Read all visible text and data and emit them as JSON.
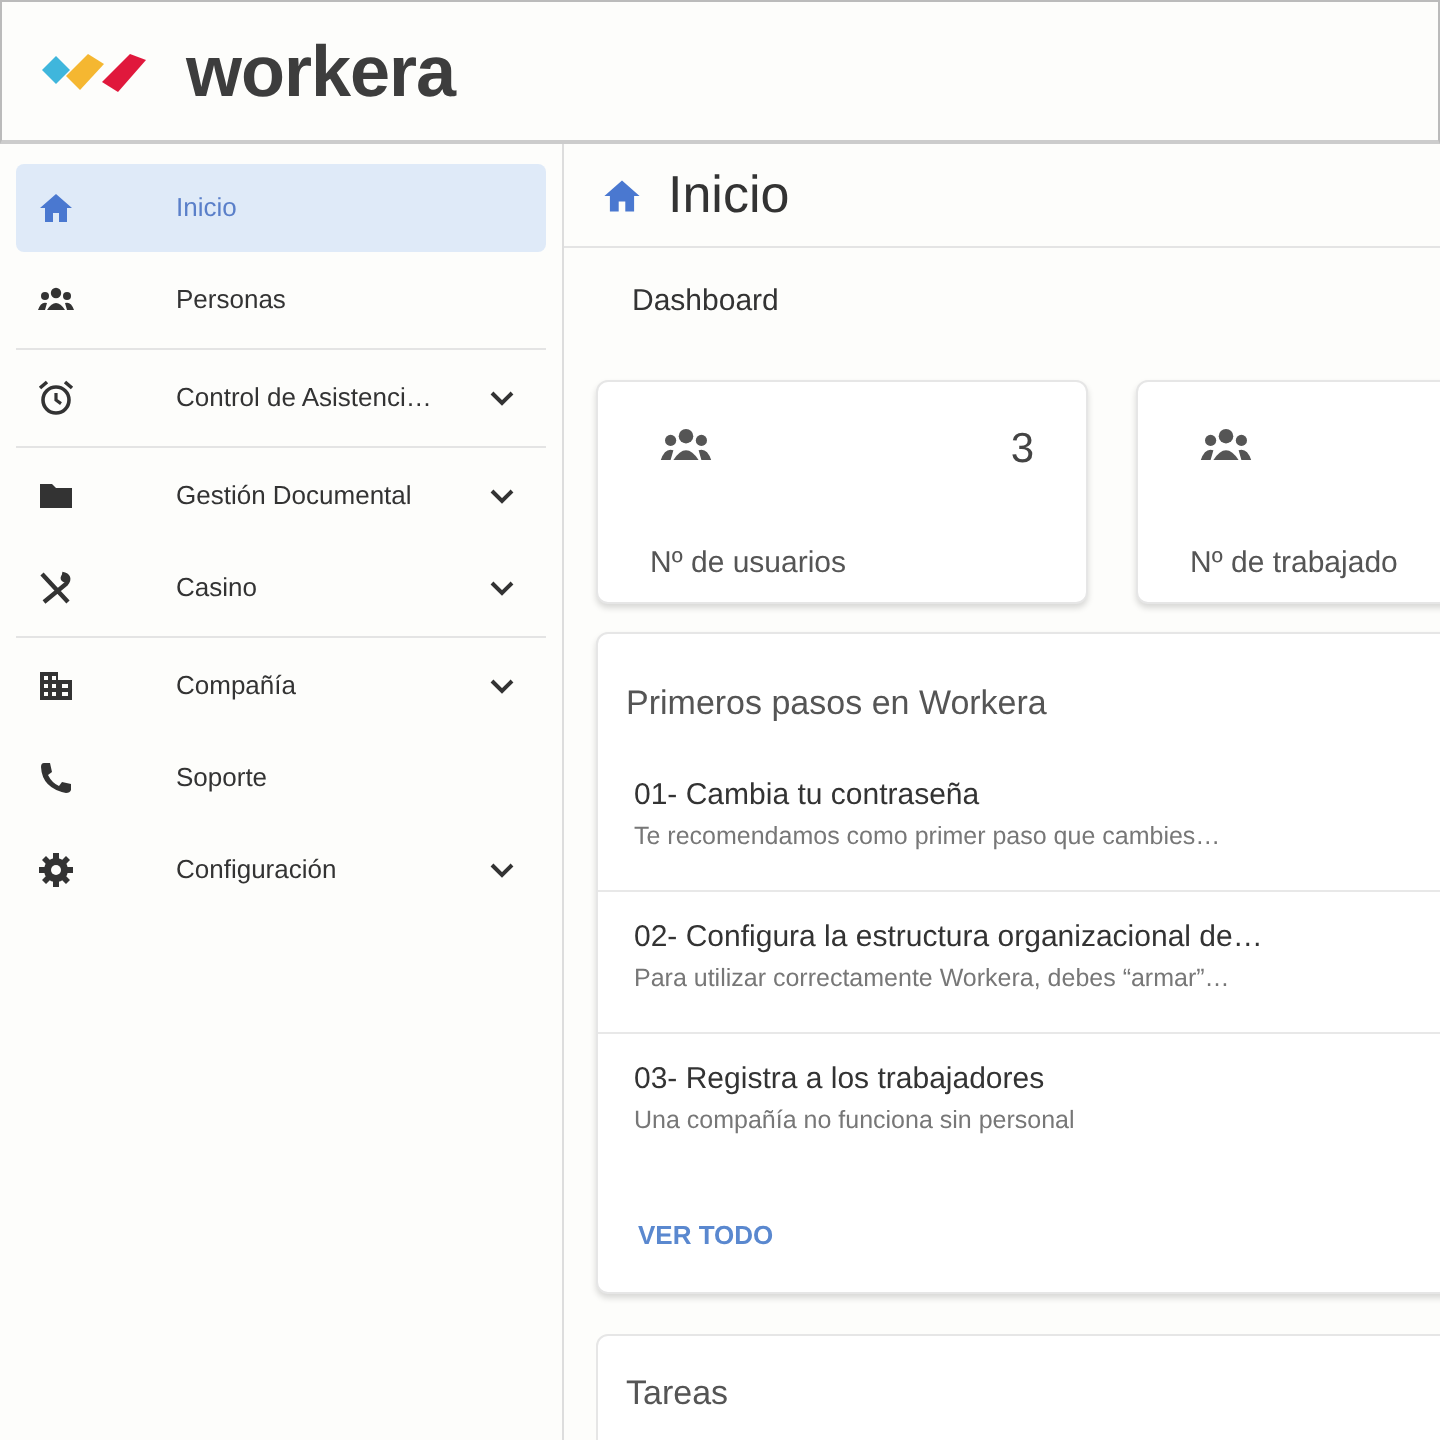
{
  "header": {
    "logo_text": "workera"
  },
  "sidebar": {
    "sections": [
      {
        "items": [
          {
            "label": "Inicio",
            "kind": "home",
            "selected": true,
            "expandable": false
          },
          {
            "label": "Personas",
            "kind": "people",
            "selected": false,
            "expandable": false
          }
        ]
      },
      {
        "items": [
          {
            "label": "Control de Asistenci…",
            "kind": "alarm",
            "selected": false,
            "expandable": true
          }
        ]
      },
      {
        "items": [
          {
            "label": "Gestión Documental",
            "kind": "folder",
            "selected": false,
            "expandable": true
          },
          {
            "label": "Casino",
            "kind": "cutlery",
            "selected": false,
            "expandable": true
          }
        ]
      },
      {
        "items": [
          {
            "label": "Compañía",
            "kind": "building",
            "selected": false,
            "expandable": true
          },
          {
            "label": "Soporte",
            "kind": "phone",
            "selected": false,
            "expandable": false
          },
          {
            "label": "Configuración",
            "kind": "gear",
            "selected": false,
            "expandable": true
          }
        ]
      }
    ]
  },
  "page": {
    "title": "Inicio",
    "breadcrumb": "Dashboard"
  },
  "stats": [
    {
      "value": "3",
      "label": "Nº de usuarios"
    },
    {
      "label": "Nº de trabajado"
    }
  ],
  "getting_started": {
    "title": "Primeros pasos en Workera",
    "steps": [
      {
        "title": "01- Cambia tu contraseña",
        "subtitle": "Te recomendamos como primer paso que cambies…"
      },
      {
        "title": "02- Configura la estructura organizacional de…",
        "subtitle": "Para utilizar correctamente Workera, debes “armar”…"
      },
      {
        "title": "03- Registra a los trabajadores",
        "subtitle": "Una compañía no funciona sin personal"
      }
    ],
    "link": "VER TODO"
  },
  "tasks": {
    "title": "Tareas"
  }
}
